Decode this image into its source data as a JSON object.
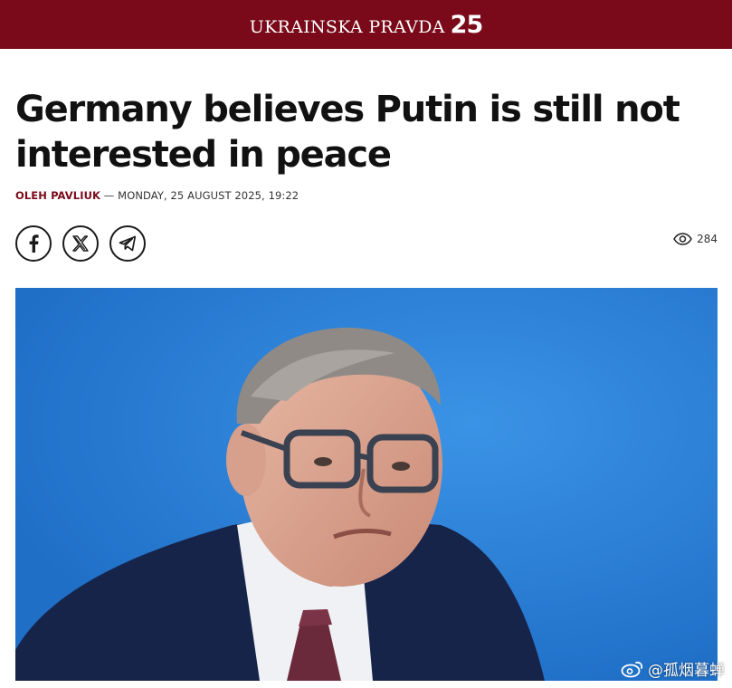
{
  "header": {
    "brand_name": "UKRAINSKA PRAVDA",
    "brand_number": "25",
    "background_color": "#7a0a1a"
  },
  "article": {
    "headline": "Germany believes Putin is still not interested in peace",
    "author": "OLEH PAVLIUK",
    "separator": " — ",
    "date": "MONDAY, 25 AUGUST 2025, 19:22",
    "views": "284"
  },
  "share": {
    "buttons": [
      {
        "name": "facebook",
        "icon": "facebook-icon"
      },
      {
        "name": "x",
        "icon": "x-icon"
      },
      {
        "name": "telegram",
        "icon": "telegram-icon"
      }
    ]
  },
  "watermark": {
    "text": "@孤烟暮蝉",
    "icon": "weibo-icon"
  },
  "colors": {
    "accent": "#7a0a1a",
    "photo_background": "#2a7fd6",
    "text": "#111111"
  }
}
